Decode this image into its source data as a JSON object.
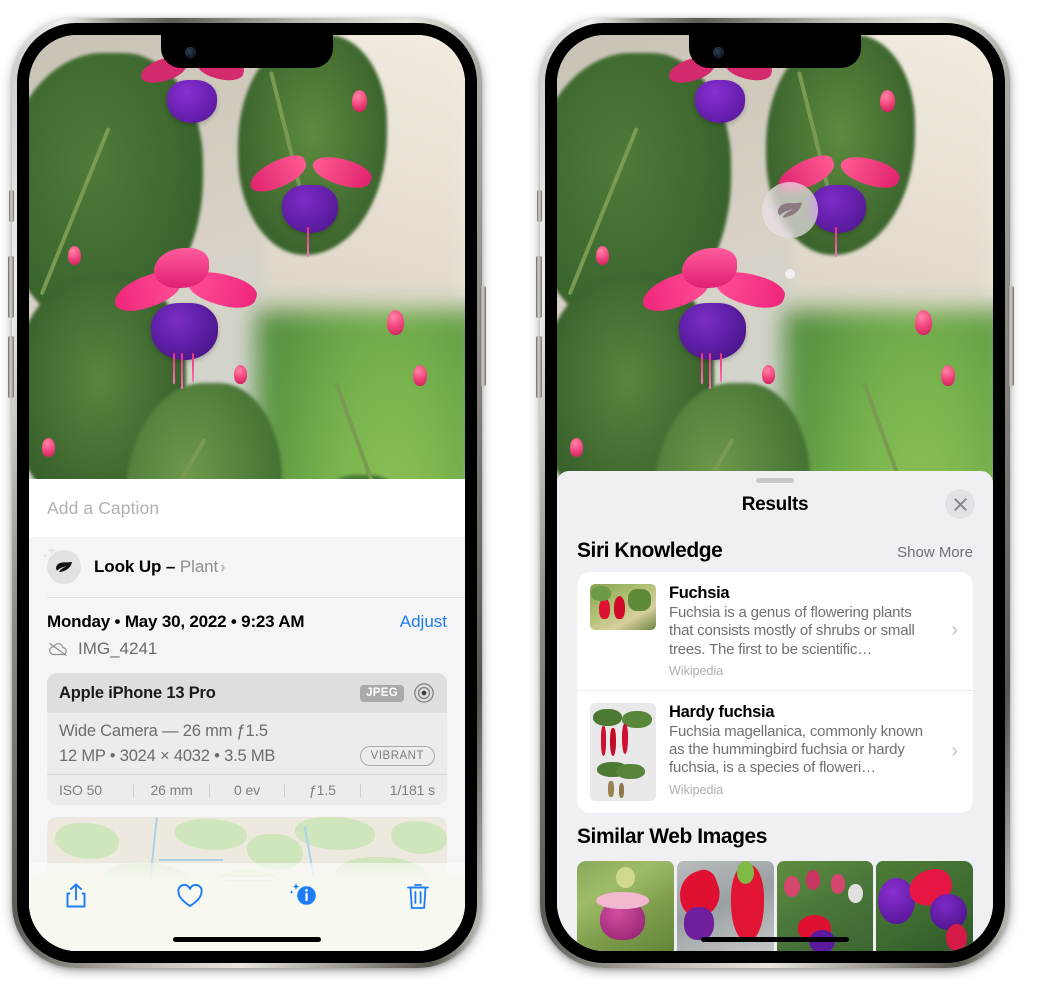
{
  "left_phone": {
    "caption_placeholder": "Add a Caption",
    "lookup": {
      "label": "Look Up – ",
      "subject": "Plant",
      "chevron": "›",
      "icon": "leaf-icon"
    },
    "metadata": {
      "date": "Monday • May 30, 2022 • 9:23 AM",
      "adjust_label": "Adjust",
      "filename": "IMG_4241",
      "cloud_icon": "icloud-slash-icon"
    },
    "camera": {
      "model": "Apple iPhone 13 Pro",
      "format_badge": "JPEG",
      "raw_icon": "aperture-icon",
      "lens": "Wide Camera — 26 mm ƒ1.5",
      "specs": "12 MP • 3024 × 4032 • 3.5 MB",
      "style_badge": "VIBRANT",
      "exif": [
        "ISO 50",
        "26 mm",
        "0 ev",
        "ƒ1.5",
        "1/181 s"
      ]
    },
    "toolbar": [
      {
        "name": "share-button",
        "icon": "share-icon"
      },
      {
        "name": "favorite-button",
        "icon": "heart-icon"
      },
      {
        "name": "info-button",
        "icon": "info-sparkle-icon"
      },
      {
        "name": "delete-button",
        "icon": "trash-icon"
      }
    ]
  },
  "right_phone": {
    "visual_lookup_badge": {
      "icon": "leaf-icon"
    },
    "sheet": {
      "title": "Results",
      "close_icon": "close-icon",
      "sections": [
        {
          "title": "Siri Knowledge",
          "action": "Show More",
          "items": [
            {
              "title": "Fuchsia",
              "description": "Fuchsia is a genus of flowering plants that consists mostly of shrubs or small trees. The first to be scientific…",
              "source": "Wikipedia",
              "chevron": "›"
            },
            {
              "title": "Hardy fuchsia",
              "description": "Fuchsia magellanica, commonly known as the hummingbird fuchsia or hardy fuchsia, is a species of floweri…",
              "source": "Wikipedia",
              "chevron": "›"
            }
          ]
        },
        {
          "title": "Similar Web Images",
          "items_count": 4
        }
      ]
    }
  },
  "colors": {
    "accent_blue": "#1c7cf5",
    "sheet_bg": "#f0eff4",
    "card_bg": "#ffffff",
    "secondary_text": "#6f6f76"
  }
}
